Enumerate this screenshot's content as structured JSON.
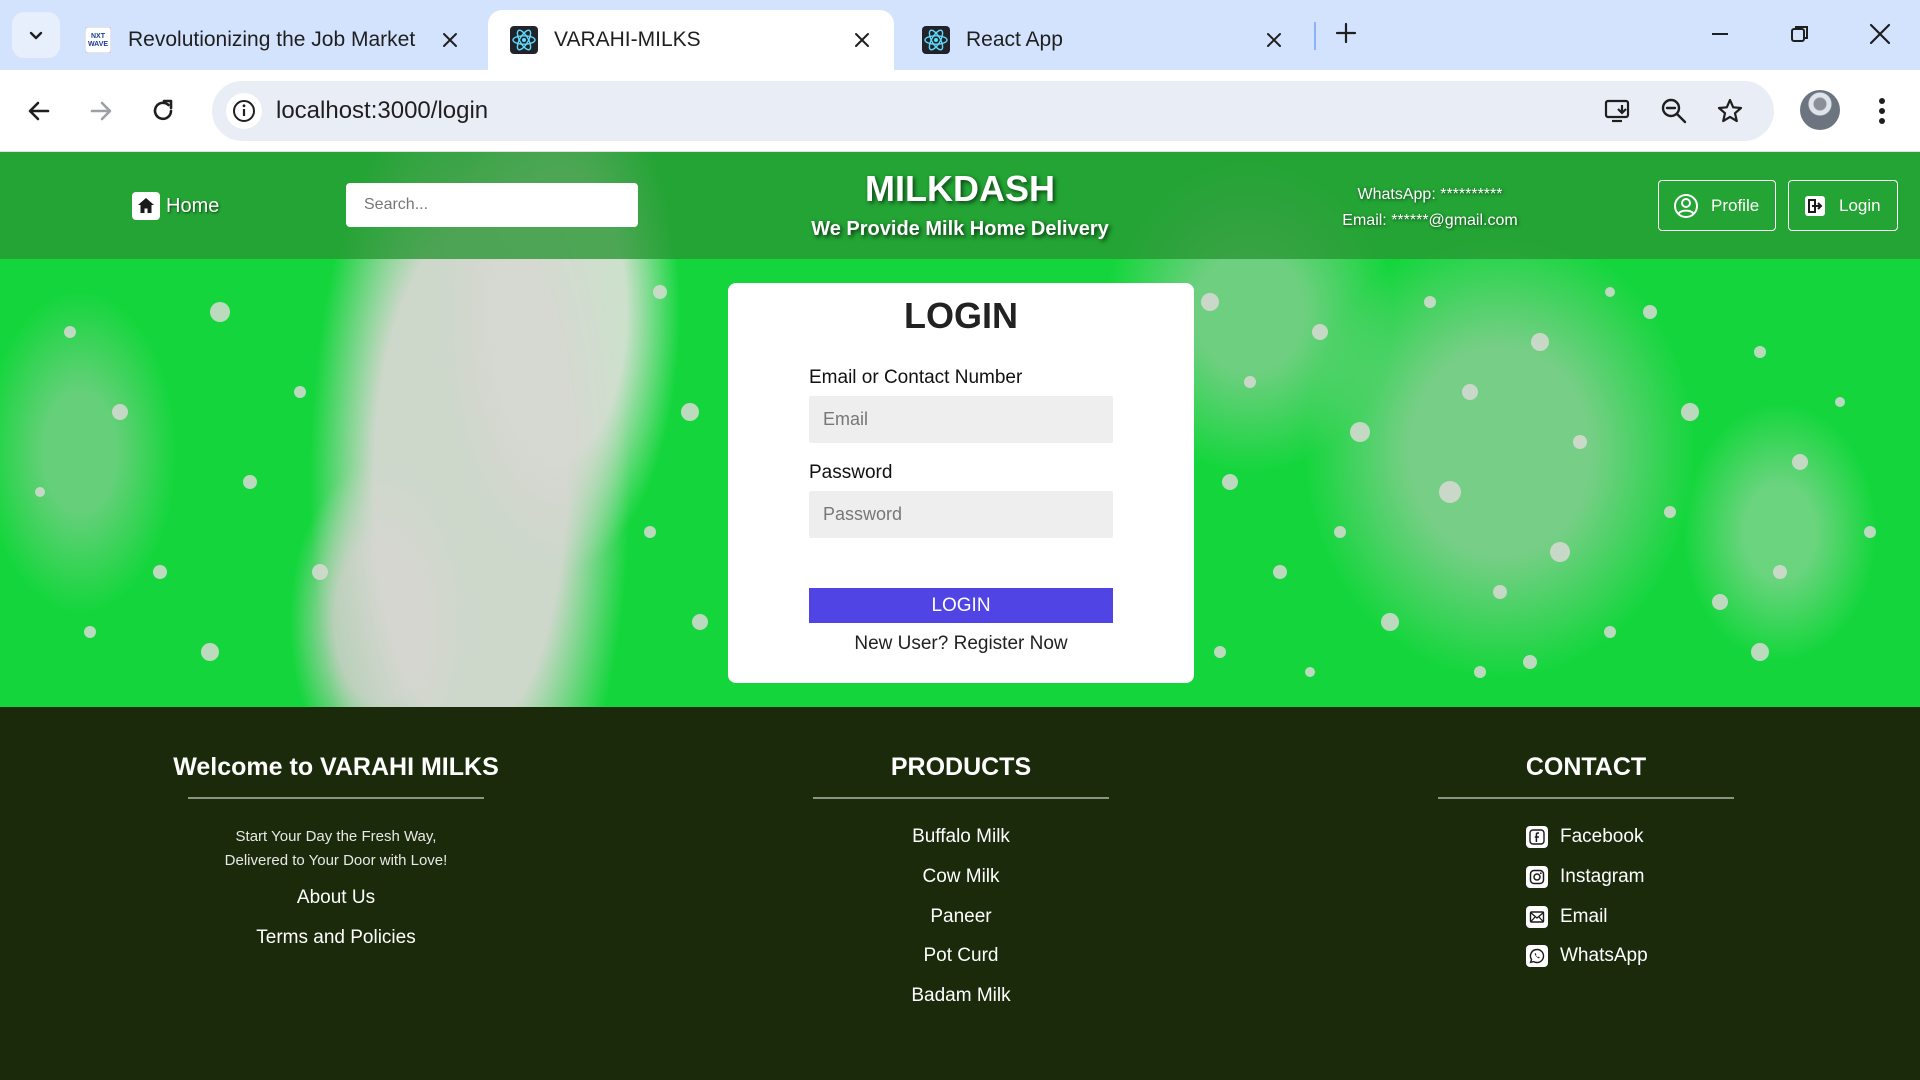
{
  "browser": {
    "tabs": [
      {
        "title": "Revolutionizing the Job Market",
        "favicon": "nxtwave-logo-icon",
        "active": false
      },
      {
        "title": "VARAHI-MILKS",
        "favicon": "react-logo-icon",
        "active": true
      },
      {
        "title": "React App",
        "favicon": "react-logo-icon",
        "active": false
      }
    ],
    "favicon_text": "NXT WAVE",
    "url": "localhost:3000/login"
  },
  "header": {
    "home_label": "Home",
    "search_placeholder": "Search...",
    "brand": "MILKDASH",
    "tagline": "We Provide Milk Home Delivery",
    "whatsapp": "WhatsApp: **********",
    "email": "Email: ******@gmail.com",
    "profile_label": "Profile",
    "login_label": "Login",
    "colors": {
      "header_bg": "#289632",
      "hero_green": "#14d63c"
    }
  },
  "login_form": {
    "title": "LOGIN",
    "email_label": "Email or Contact Number",
    "email_placeholder": "Email",
    "password_label": "Password",
    "password_placeholder": "Password",
    "submit_label": "LOGIN",
    "register_text": "New User? Register Now",
    "button_color": "#5044e4"
  },
  "footer": {
    "welcome_title": "Welcome to VARAHI MILKS",
    "welcome_line1": "Start Your Day the Fresh Way,",
    "welcome_line2": "Delivered to Your Door with Love!",
    "about_label": "About Us",
    "terms_label": "Terms and Policies",
    "products_title": "PRODUCTS",
    "products": [
      "Buffalo Milk",
      "Cow Milk",
      "Paneer",
      "Pot Curd",
      "Badam Milk"
    ],
    "contact_title": "CONTACT",
    "contacts": [
      {
        "label": "Facebook",
        "icon": "facebook-icon"
      },
      {
        "label": "Instagram",
        "icon": "instagram-icon"
      },
      {
        "label": "Email",
        "icon": "email-icon"
      },
      {
        "label": "WhatsApp",
        "icon": "whatsapp-icon"
      }
    ],
    "bg_color": "#1a2a0a"
  }
}
